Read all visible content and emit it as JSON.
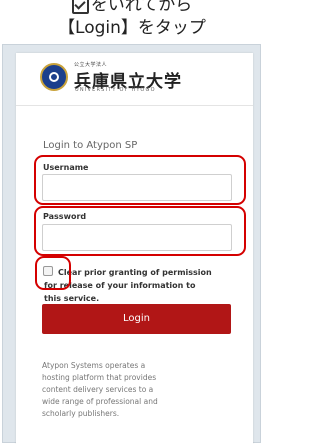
{
  "caption": {
    "line1_text": "をいれてから",
    "line2_text": "【Login】をタップ"
  },
  "logo": {
    "small_text": "公立大学法人",
    "name": "兵庫県立大学",
    "english": "UNIVERSITY OF HYOGO"
  },
  "form": {
    "title": "Login to Atypon SP",
    "username_label": "Username",
    "username_value": "",
    "password_label": "Password",
    "password_value": "",
    "consent_text": "Clear prior granting of permission for release of your information to this service.",
    "consent_checked": false,
    "login_button": "Login"
  },
  "about_text": "Atypon Systems operates a hosting platform that provides content delivery services to a wide range of professional and scholarly publishers.",
  "colors": {
    "highlight": "#d40000",
    "button": "#b11616",
    "page_bg": "#dfe6ec"
  }
}
